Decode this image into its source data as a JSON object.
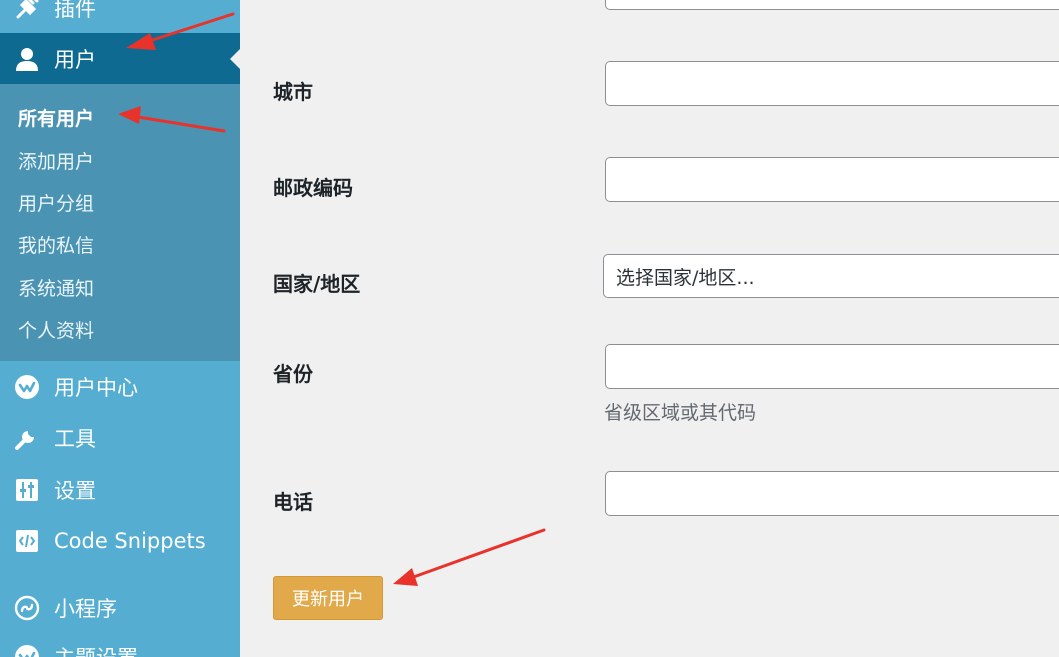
{
  "sidebar": {
    "items": [
      {
        "label": "插件",
        "icon": "plugin-icon"
      },
      {
        "label": "用户",
        "icon": "user-icon",
        "current": true
      },
      {
        "label": "用户中心",
        "icon": "user-center-icon"
      },
      {
        "label": "工具",
        "icon": "wrench-icon"
      },
      {
        "label": "设置",
        "icon": "settings-sliders-icon"
      },
      {
        "label": "Code Snippets",
        "icon": "code-snippets-icon"
      },
      {
        "label": "小程序",
        "icon": "mini-program-icon"
      },
      {
        "label": "主题设置",
        "icon": "theme-settings-icon"
      }
    ],
    "submenu": [
      {
        "label": "所有用户",
        "active": true
      },
      {
        "label": "添加用户"
      },
      {
        "label": "用户分组"
      },
      {
        "label": "我的私信"
      },
      {
        "label": "系统通知"
      },
      {
        "label": "个人资料"
      }
    ]
  },
  "form": {
    "city": {
      "label": "城市",
      "value": ""
    },
    "postcode": {
      "label": "邮政编码",
      "value": ""
    },
    "country": {
      "label": "国家/地区",
      "value": "选择国家/地区..."
    },
    "state": {
      "label": "省份",
      "value": "",
      "hint": "省级区域或其代码"
    },
    "phone": {
      "label": "电话",
      "value": ""
    }
  },
  "update_button_label": "更新用户",
  "colors": {
    "sidebar_bg": "#55aed1",
    "sidebar_current": "#0f6a92",
    "submenu_bg": "#4a93b3",
    "button": "#e2a94a",
    "annotation_arrow": "#e8322a"
  }
}
